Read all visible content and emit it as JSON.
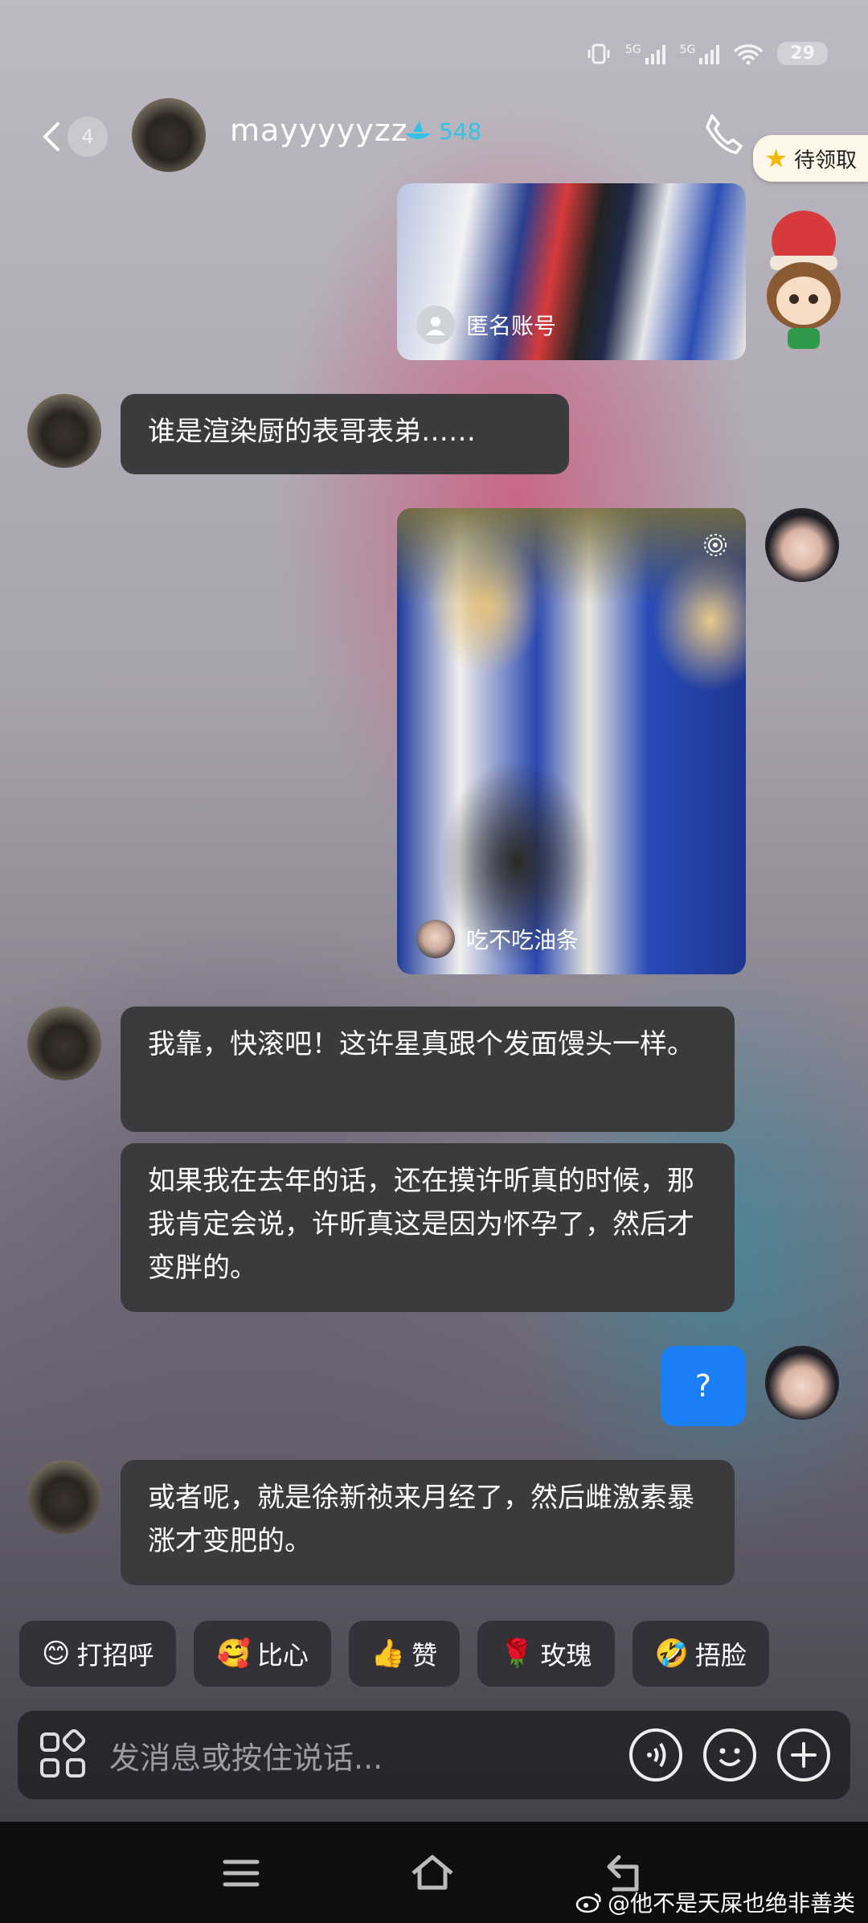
{
  "status_bar": {
    "signal1": "5G",
    "signal2": "5G",
    "battery": "29"
  },
  "header": {
    "unread_count": "4",
    "username": "mayyyyyzz",
    "streak": "548",
    "pending_label": "待领取"
  },
  "messages": {
    "m1_tag": "匿名账号",
    "m2_text": "谁是渲染厨的表哥表弟……",
    "m3_tag": "吃不吃油条",
    "m4_text": "我靠，快滚吧！这许星真跟个发面馒头一样。",
    "m5_text": "如果我在去年的话，还在摸许昕真的时候，那我肯定会说，许昕真这是因为怀孕了，然后才变胖的。",
    "m6_text": "?",
    "m7_text": "或者呢，就是徐新祯来月经了，然后雌激素暴涨才变肥的。"
  },
  "quick_replies": [
    {
      "emoji": "😊",
      "label": "打招呼"
    },
    {
      "emoji": "🥰",
      "label": "比心"
    },
    {
      "emoji": "👍",
      "label": "赞"
    },
    {
      "emoji": "🌹",
      "label": "玫瑰"
    },
    {
      "emoji": "🤣",
      "label": "捂脸"
    }
  ],
  "input": {
    "placeholder": "发消息或按住说话..."
  },
  "watermark": "@他不是天屎也绝非善类",
  "colors": {
    "bubble_self": "#1a7ef5",
    "bubble_other": "#3b3b3e",
    "streak": "#31c3e6"
  }
}
